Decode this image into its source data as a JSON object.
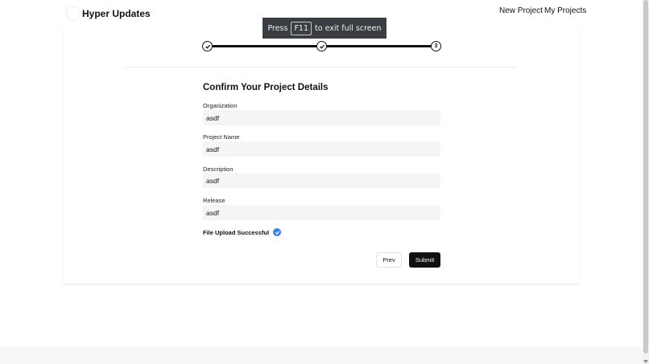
{
  "navbar": {
    "brand": "Hyper Updates",
    "logo_icon": "brand-logo-icon",
    "links": [
      {
        "label": "New Project"
      },
      {
        "label": "My Projects"
      }
    ]
  },
  "overlay": {
    "press": "Press",
    "key": "F11",
    "message": "to exit full screen"
  },
  "stepper": {
    "steps": [
      {
        "state": "complete",
        "icon": "check-icon"
      },
      {
        "state": "complete",
        "icon": "check-icon"
      },
      {
        "state": "current",
        "number": "3"
      }
    ]
  },
  "form": {
    "title": "Confirm Your Project Details",
    "fields": [
      {
        "label": "Organization",
        "value": "asdf"
      },
      {
        "label": "Project Name",
        "value": "asdf"
      },
      {
        "label": "Description",
        "value": "asdf"
      },
      {
        "label": "Release",
        "value": "asdf"
      }
    ],
    "upload_status": "File Upload Successful",
    "upload_icon": "check-circle-icon",
    "prev_label": "Prev",
    "submit_label": "Submit"
  },
  "colors": {
    "accent": "#3b82f6",
    "primary_button": "#111111",
    "field_bg": "#f5f5f5"
  }
}
